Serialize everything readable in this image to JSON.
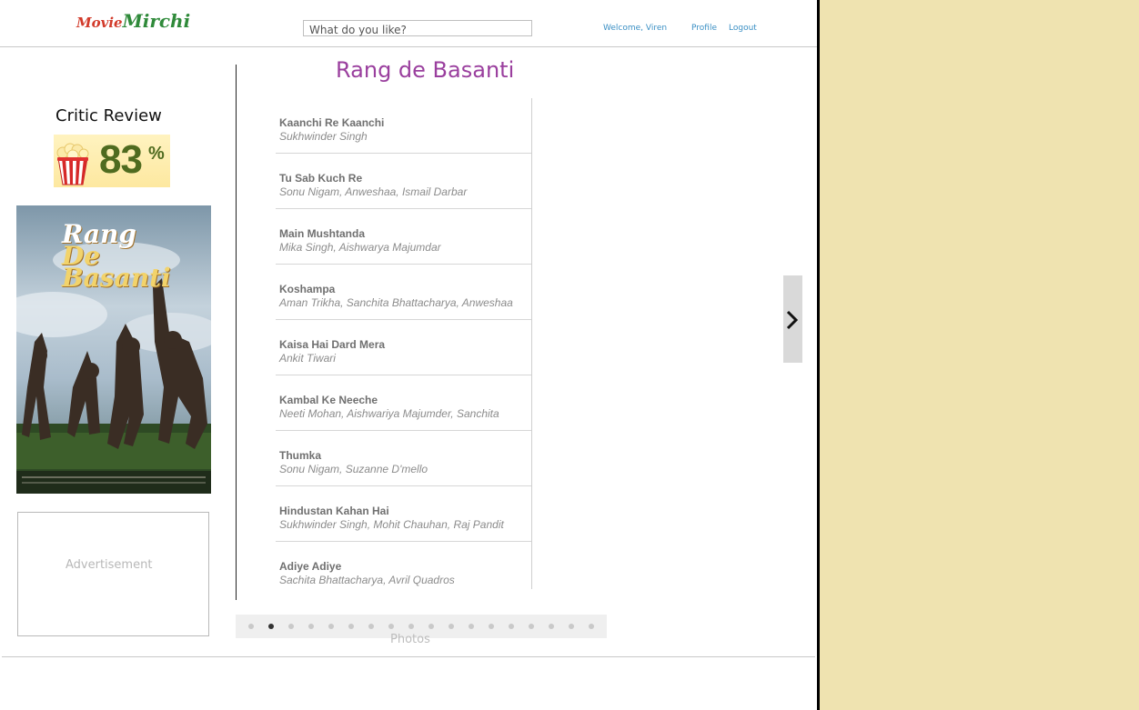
{
  "header": {
    "logo_part1": "Movie",
    "logo_part2": "Mirchi",
    "search_placeholder": "What do you like?",
    "welcome": "Welcome, Viren",
    "profile": "Profile",
    "logout": "Logout"
  },
  "critic": {
    "title": "Critic Review",
    "score": "83",
    "unit": "%"
  },
  "poster": {
    "title_line1": "Rang",
    "title_line2": "De Basanti"
  },
  "ad": {
    "label": "Advertisement"
  },
  "movie": {
    "title": "Rang de Basanti"
  },
  "songs": [
    {
      "title": "Kaanchi Re Kaanchi",
      "artists": "Sukhwinder Singh"
    },
    {
      "title": "Tu Sab Kuch Re",
      "artists": "Sonu Nigam, Anweshaa, Ismail Darbar"
    },
    {
      "title": "Main Mushtanda",
      "artists": "Mika Singh, Aishwarya Majumdar"
    },
    {
      "title": "Koshampa",
      "artists": "Aman Trikha, Sanchita Bhattacharya, Anweshaa"
    },
    {
      "title": "Kaisa Hai Dard Mera",
      "artists": "Ankit Tiwari"
    },
    {
      "title": "Kambal Ke Neeche",
      "artists": "Neeti Mohan, Aishwariya Majumder, Sanchita"
    },
    {
      "title": "Thumka",
      "artists": "Sonu Nigam, Suzanne D'mello"
    },
    {
      "title": "Hindustan Kahan Hai",
      "artists": "Sukhwinder Singh, Mohit Chauhan, Raj Pandit"
    },
    {
      "title": "Adiye Adiye",
      "artists": "Sachita Bhattacharya, Avril Quadros"
    }
  ],
  "gallery": {
    "label": "Photos",
    "dot_count": 18,
    "active_index": 1
  },
  "colors": {
    "title_purple": "#9a3f9e",
    "link_blue": "#3a8fc4",
    "side_panel": "#efe3b0",
    "score_green": "#4f6b1f"
  },
  "icons": {
    "next": "chevron-right-icon",
    "popcorn": "popcorn-icon"
  }
}
